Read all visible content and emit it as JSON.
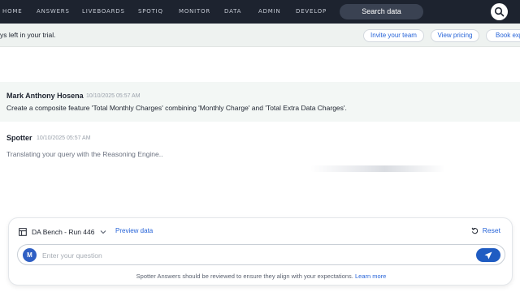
{
  "nav": {
    "items": [
      "HOME",
      "ANSWERS",
      "LIVEBOARDS",
      "SPOTIQ",
      "MONITOR",
      "DATA",
      "ADMIN",
      "DEVELOP"
    ],
    "search_label": "Search data",
    "colors": {
      "bg": "#1d232f",
      "pill": "#3a4252"
    }
  },
  "banner": {
    "text": "ys left in your trial.",
    "buttons": [
      "Invite your team",
      "View pricing",
      "Book exp"
    ]
  },
  "messages": {
    "user": {
      "name": "Mark Anthony Hosena",
      "time": "10/10/2025 05:57 AM",
      "text": "Create a composite feature 'Total Monthly Charges' combining 'Monthly Charge' and 'Total Extra Data Charges'."
    },
    "bot": {
      "name": "Spotter",
      "time": "10/10/2025 05:57 AM",
      "text": "Translating your query with the Reasoning Engine.."
    }
  },
  "panel": {
    "datasource": "DA Bench - Run 446",
    "preview": "Preview data",
    "reset": "Reset",
    "avatar_initial": "M",
    "placeholder": "Enter your question",
    "disclaimer": "Spotter Answers should be reviewed to ensure they align with your expectations.",
    "learn_more": "Learn more"
  },
  "accent": "#2764d8"
}
